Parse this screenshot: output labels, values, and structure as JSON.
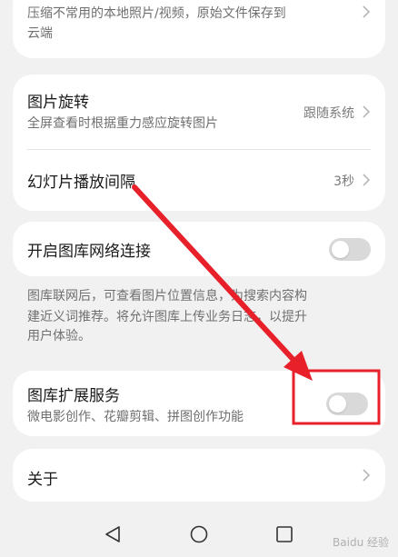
{
  "compress": {
    "desc_line1": "压缩不常用的本地照片/视频，原始文件保存到",
    "desc_line2": "云端"
  },
  "rotate": {
    "title": "图片旋转",
    "desc": "全屏查看时根据重力感应旋转图片",
    "value": "跟随系统"
  },
  "slideshow": {
    "title": "幻灯片播放间隔",
    "value": "3秒"
  },
  "network": {
    "title": "开启图库网络连接",
    "toggle_on": false,
    "note_line1": "图库联网后，可查看图片位置信息，为搜索内容构",
    "note_line2": "建近义词推荐。将允许图库上传业务日志，以提升",
    "note_line3": "用户体验。"
  },
  "extension": {
    "title": "图库扩展服务",
    "desc": "微电影创作、花瓣剪辑、拼图创作功能",
    "toggle_on": false
  },
  "about": {
    "title": "关于"
  },
  "annotation": {
    "color": "#e8202a"
  },
  "navbar": {
    "icons": [
      "back-icon",
      "home-icon",
      "recents-icon"
    ]
  },
  "watermark": {
    "text": "Baidu 经验"
  }
}
